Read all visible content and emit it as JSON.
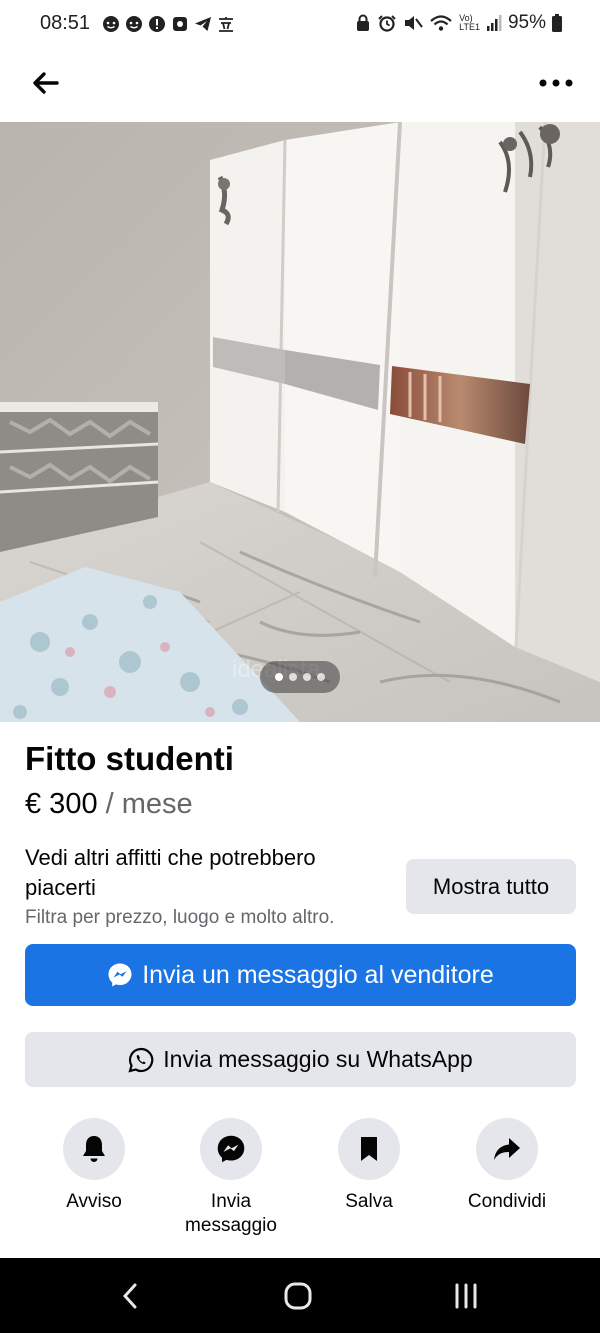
{
  "status_bar": {
    "time": "08:51",
    "battery": "95%",
    "network_badge_top": "Vo)",
    "network_badge_bottom": "LTE1"
  },
  "nav": {
    "back_icon": "arrow-left-icon",
    "more_icon": "more-horizontal-icon"
  },
  "photo": {
    "watermark": "idealista",
    "carousel_dots": 4,
    "active_dot": 0
  },
  "listing": {
    "title": "Fitto studenti",
    "price": "€ 300",
    "price_unit": " / mese"
  },
  "suggestions": {
    "text": "Vedi altri affitti che potrebbero piacerti",
    "subtext": "Filtra per prezzo, luogo e molto altro.",
    "show_all_label": "Mostra tutto"
  },
  "buttons": {
    "message_seller": "Invia un messaggio al venditore",
    "whatsapp": "Invia messaggio su WhatsApp"
  },
  "actions": [
    {
      "label": "Avviso",
      "icon": "bell-icon"
    },
    {
      "label": "Invia messaggio",
      "icon": "messenger-icon"
    },
    {
      "label": "Salva",
      "icon": "bookmark-icon"
    },
    {
      "label": "Condividi",
      "icon": "share-icon"
    }
  ],
  "colors": {
    "primary_button": "#1b74e4",
    "secondary_button": "#e4e6eb",
    "secondary_text": "#65676b"
  }
}
